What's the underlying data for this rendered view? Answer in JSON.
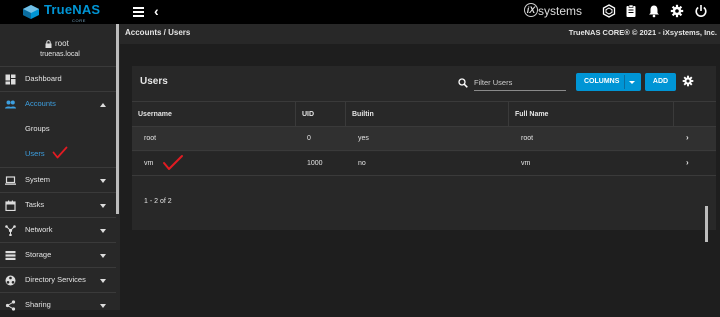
{
  "topbar": {
    "logo_text": "TrueNAS",
    "logo_sub": "CORE",
    "vendor_ix": "iX",
    "vendor_systems": "systems",
    "icons": [
      "menu-icon",
      "back-icon",
      "truecommand-icon",
      "clipboard-icon",
      "bell-icon",
      "gear-icon",
      "power-icon"
    ]
  },
  "sidebar": {
    "user": "root",
    "host": "truenas.local",
    "items": [
      {
        "label": "Dashboard",
        "icon": "dashboard-icon"
      },
      {
        "label": "Accounts",
        "icon": "people-icon"
      },
      {
        "label": "Groups"
      },
      {
        "label": "Users"
      },
      {
        "label": "System",
        "icon": "laptop-icon"
      },
      {
        "label": "Tasks",
        "icon": "calendar-icon"
      },
      {
        "label": "Network",
        "icon": "network-icon"
      },
      {
        "label": "Storage",
        "icon": "storage-icon"
      },
      {
        "label": "Directory Services",
        "icon": "directory-icon"
      },
      {
        "label": "Sharing",
        "icon": "share-icon"
      }
    ]
  },
  "breadcrumb": "Accounts / Users",
  "copyright": "TrueNAS CORE® © 2021 - iXsystems, Inc.",
  "card": {
    "title": "Users",
    "search_placeholder": "Filter Users",
    "columns_label": "COLUMNS",
    "add_label": "ADD",
    "headers": [
      "Username",
      "UID",
      "Builtin",
      "Full Name"
    ],
    "rows": [
      [
        "root",
        "0",
        "yes",
        "root"
      ],
      [
        "vm",
        "1000",
        "no",
        "vm"
      ]
    ],
    "row_chevron": "›",
    "pager": "1 - 2 of 2"
  },
  "colors": {
    "accent": "#0095d5",
    "active_nav": "#3d9fe0",
    "annotation": "#e11b22"
  }
}
